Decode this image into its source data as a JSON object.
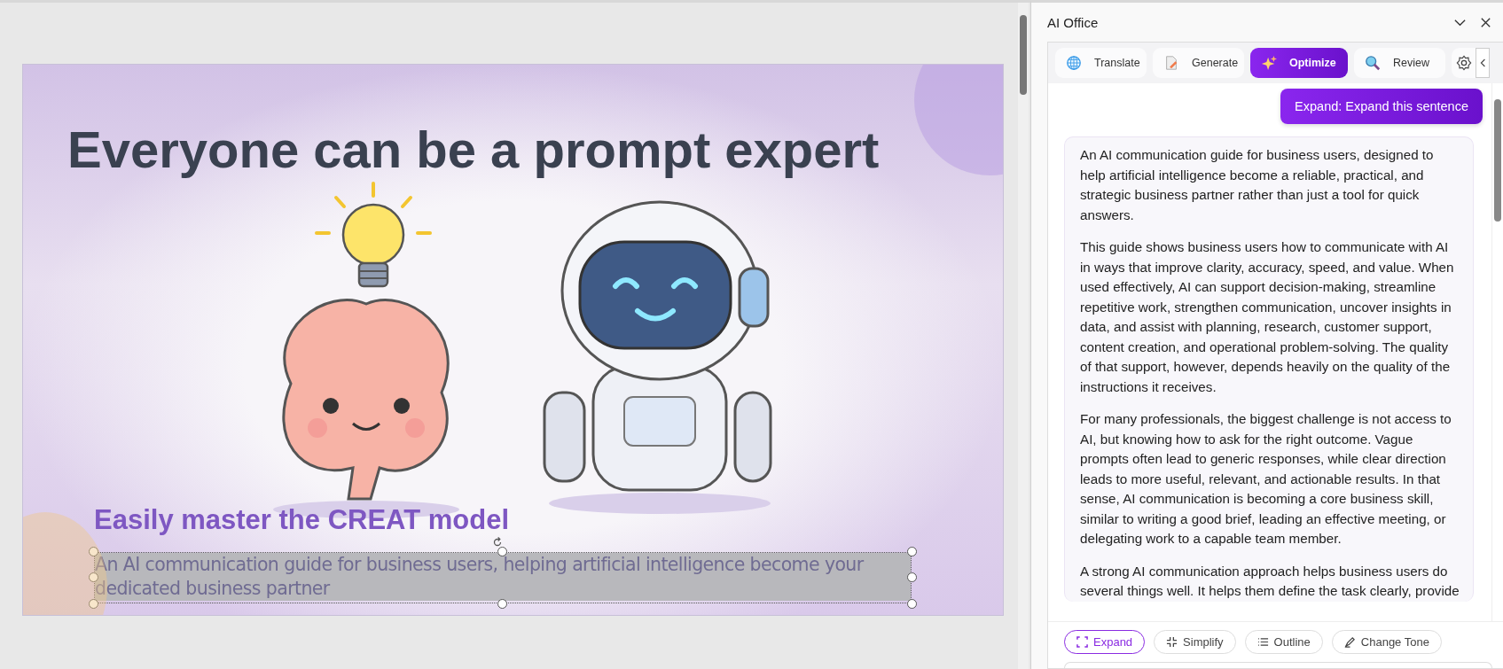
{
  "slide": {
    "title": "Everyone can be a prompt expert",
    "subtitle": "Easily master the CREAT model",
    "body": "An AI communication guide for business users, helping artificial intelligence become your dedicated business partner",
    "body_selected": true
  },
  "panel": {
    "title": "AI Office",
    "tabs": [
      {
        "label": "Translate",
        "kind": "translate",
        "selected": false
      },
      {
        "label": "Generate",
        "kind": "generate",
        "selected": false
      },
      {
        "label": "Optimize",
        "kind": "optimize",
        "selected": true
      },
      {
        "label": "Review",
        "kind": "review",
        "selected": false
      }
    ],
    "request": "Expand: Expand this sentence",
    "response": [
      "An AI communication guide for business users, designed to help artificial intelligence become a reliable, practical, and strategic business partner rather than just a tool for quick answers.",
      "This guide shows business users how to communicate with AI in ways that improve clarity, accuracy, speed, and value. When used effectively, AI can support decision-making, streamline repetitive work, strengthen communication, uncover insights in data, and assist with planning, research, customer support, content creation, and operational problem-solving. The quality of that support, however, depends heavily on the quality of the instructions it receives.",
      "For many professionals, the biggest challenge is not access to AI, but knowing how to ask for the right outcome. Vague prompts often lead to generic responses, while clear direction leads to more useful, relevant, and actionable results. In that sense, AI communication is becoming a core business skill, similar to writing a good brief, leading an effective meeting, or delegating work to a capable team member.",
      "A strong AI communication approach helps business users do several things well. It helps them define the task clearly, provide"
    ],
    "actions": [
      {
        "label": "Expand",
        "kind": "expand",
        "selected": true
      },
      {
        "label": "Simplify",
        "kind": "simplify",
        "selected": false
      },
      {
        "label": "Outline",
        "kind": "outline",
        "selected": false
      },
      {
        "label": "Change Tone",
        "kind": "tone",
        "selected": false
      }
    ]
  }
}
